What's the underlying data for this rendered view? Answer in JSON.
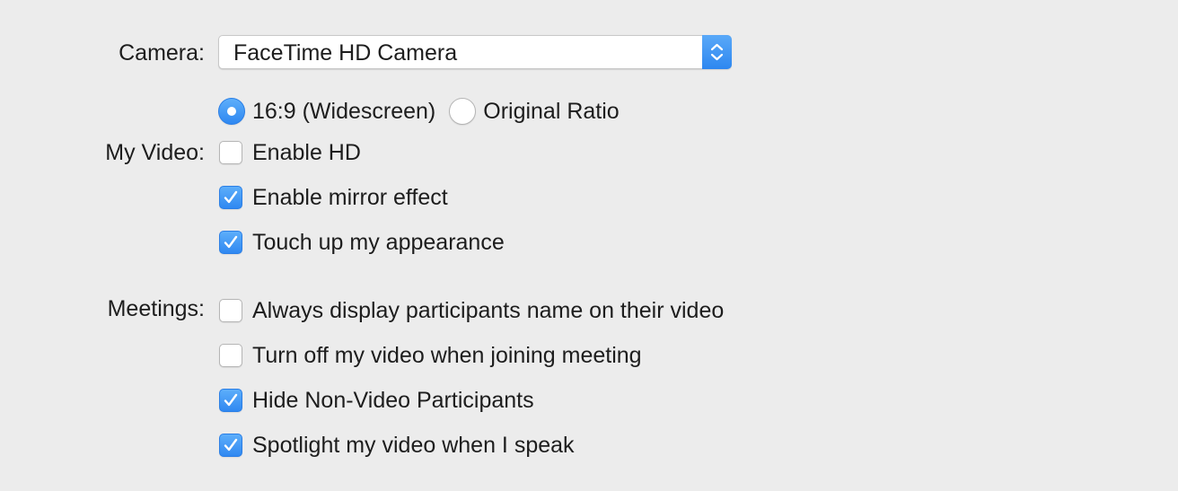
{
  "camera": {
    "label": "Camera:",
    "selected": "FaceTime HD Camera"
  },
  "my_video": {
    "label": "My Video:",
    "ratio_options": [
      {
        "label": "16:9 (Widescreen)",
        "selected": true
      },
      {
        "label": "Original Ratio",
        "selected": false
      }
    ],
    "options": [
      {
        "label": "Enable HD",
        "checked": false
      },
      {
        "label": "Enable mirror effect",
        "checked": true
      },
      {
        "label": "Touch up my appearance",
        "checked": true
      }
    ]
  },
  "meetings": {
    "label": "Meetings:",
    "options": [
      {
        "label": "Always display participants name on their video",
        "checked": false
      },
      {
        "label": "Turn off my video when joining meeting",
        "checked": false
      },
      {
        "label": "Hide Non-Video Participants",
        "checked": true
      },
      {
        "label": "Spotlight my video when I speak",
        "checked": true
      }
    ]
  },
  "colors": {
    "accent": "#2f88f1",
    "background": "#ececec"
  },
  "icons": {
    "select_arrows": "chevron-up-down-icon",
    "checkmark": "checkmark-icon"
  }
}
